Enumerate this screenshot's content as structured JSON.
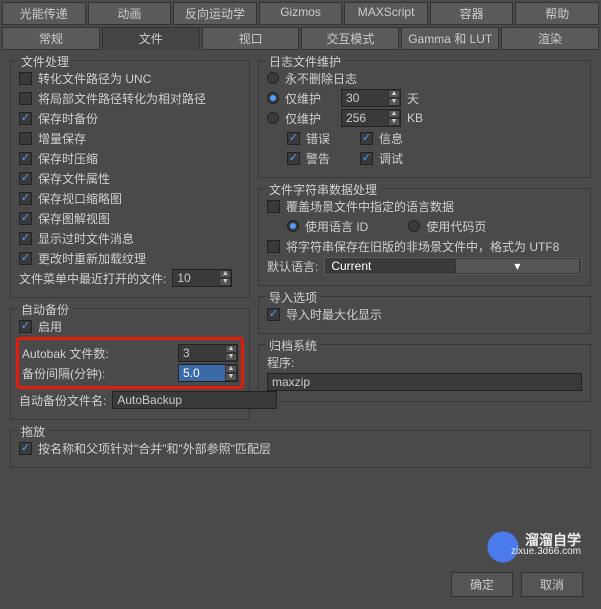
{
  "tabs_row1": [
    "光能传递",
    "动画",
    "反向运动学",
    "Gizmos",
    "MAXScript",
    "容器",
    "帮助"
  ],
  "tabs_row2": [
    "常规",
    "文件",
    "视口",
    "交互模式",
    "Gamma 和 LUT",
    "渲染"
  ],
  "active_tab": "文件",
  "file_handling": {
    "title": "文件处理",
    "items": [
      {
        "label": "转化文件路径为 UNC",
        "checked": false
      },
      {
        "label": "将局部文件路径转化为相对路径",
        "checked": false
      },
      {
        "label": "保存时备份",
        "checked": true
      },
      {
        "label": "增量保存",
        "checked": false
      },
      {
        "label": "保存时压缩",
        "checked": true
      },
      {
        "label": "保存文件属性",
        "checked": true
      },
      {
        "label": "保存视口缩略图",
        "checked": true
      },
      {
        "label": "保存图解视图",
        "checked": true
      },
      {
        "label": "显示过时文件消息",
        "checked": true
      },
      {
        "label": "更改时重新加载纹理",
        "checked": true
      }
    ],
    "recent_label": "文件菜单中最近打开的文件:",
    "recent_value": "10"
  },
  "auto_backup": {
    "title": "自动备份",
    "enable_label": "启用",
    "enable_checked": true,
    "count_label": "Autobak 文件数:",
    "count_value": "3",
    "interval_label": "备份间隔(分钟):",
    "interval_value": "5.0",
    "name_label": "自动备份文件名:",
    "name_value": "AutoBackup"
  },
  "dragdrop": {
    "title": "拖放",
    "item_label": "按名称和父项针对\"合并\"和\"外部参照\"匹配层",
    "item_checked": true
  },
  "log": {
    "title": "日志文件维护",
    "never_delete": {
      "label": "永不删除日志",
      "checked": false
    },
    "maintain_days": {
      "label": "仅维护",
      "value": "30",
      "unit": "天",
      "checked": true
    },
    "maintain_kb": {
      "label": "仅维护",
      "value": "256",
      "unit": "KB",
      "checked": false
    },
    "flags": [
      {
        "label": "错误",
        "checked": true
      },
      {
        "label": "信息",
        "checked": true
      },
      {
        "label": "警告",
        "checked": true
      },
      {
        "label": "调试",
        "checked": true
      }
    ]
  },
  "string": {
    "title": "文件字符串数据处理",
    "override": {
      "label": "覆盖场景文件中指定的语言数据",
      "checked": false
    },
    "radios": [
      {
        "label": "使用语言 ID",
        "checked": true
      },
      {
        "label": "使用代码页",
        "checked": false
      }
    ],
    "utf8": {
      "label": "将字符串保存在旧版的非场景文件中，格式为 UTF8",
      "checked": false
    },
    "default_lang_label": "默认语言:",
    "default_lang_value": "Current"
  },
  "import": {
    "title": "导入选项",
    "maximize": {
      "label": "导入时最大化显示",
      "checked": true
    }
  },
  "archive": {
    "title": "归档系统",
    "prog_label": "程序:",
    "prog_value": "maxzip"
  },
  "buttons": {
    "ok": "确定",
    "cancel": "取消"
  },
  "watermark": {
    "big": "溜溜自学",
    "small": "zixue.3d66.com"
  }
}
